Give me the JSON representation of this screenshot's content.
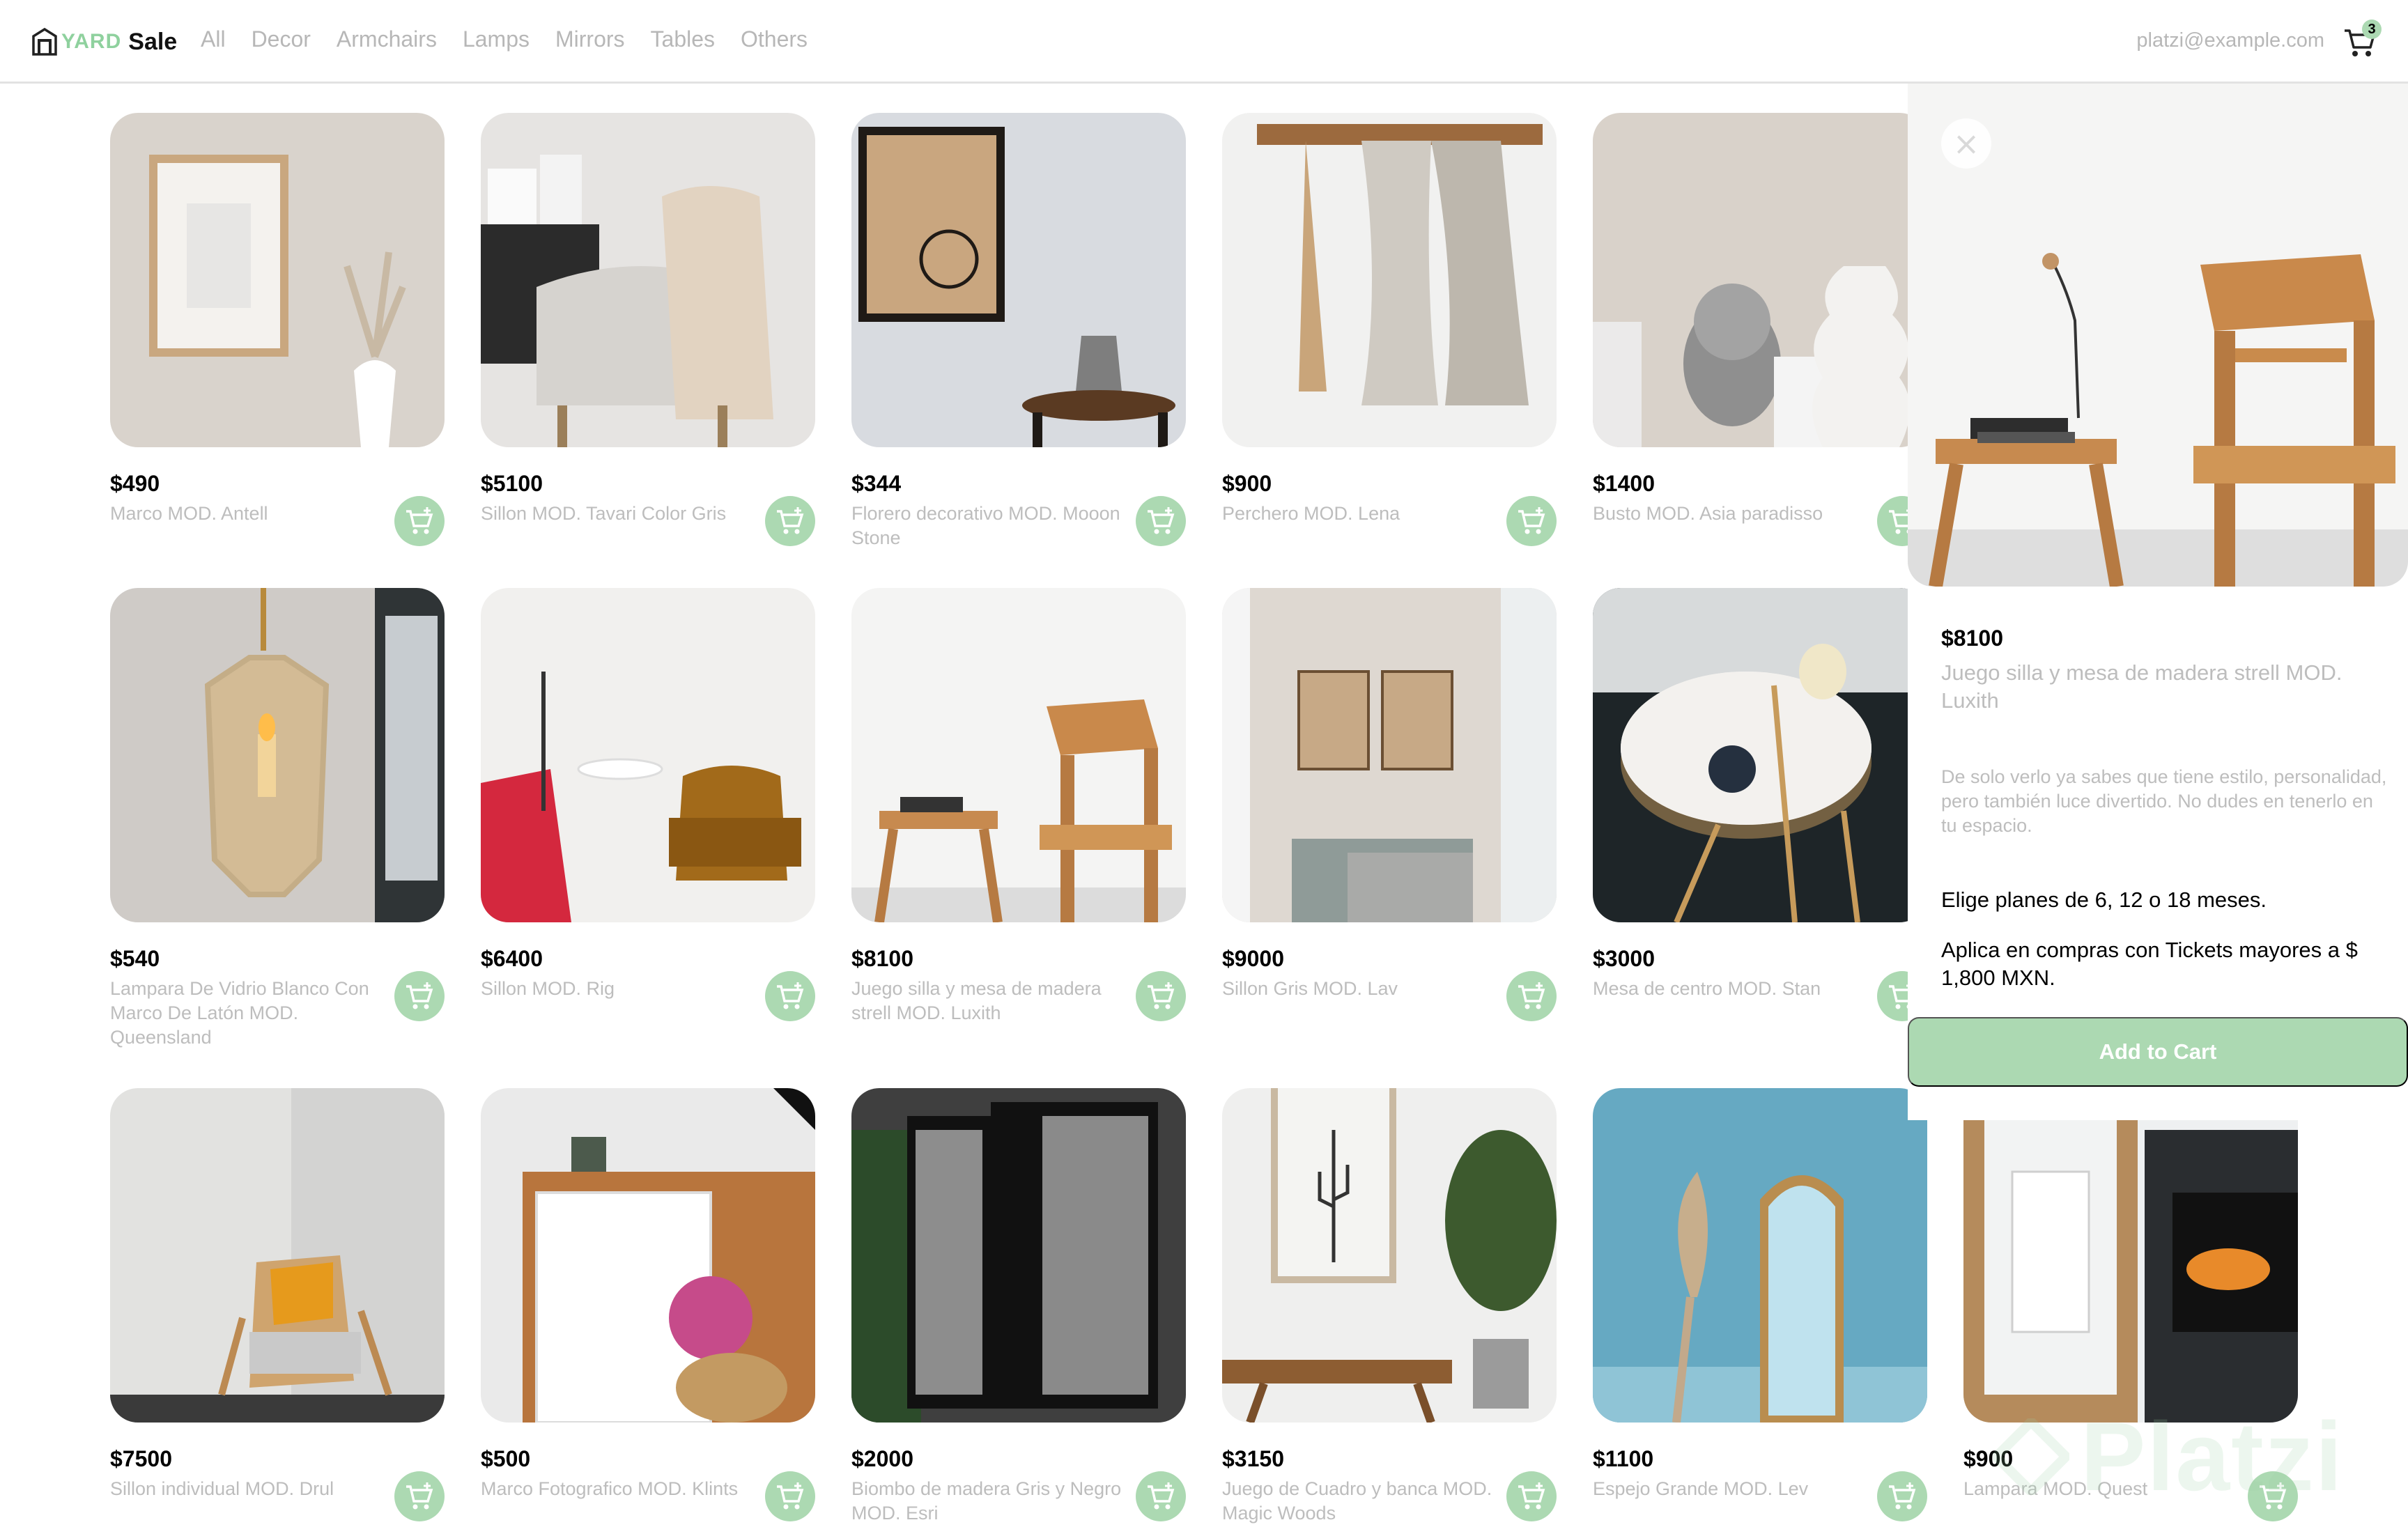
{
  "navbar": {
    "logo_yard": "YARD",
    "logo_sale": "Sale",
    "links": [
      "All",
      "Decor",
      "Armchairs",
      "Lamps",
      "Mirrors",
      "Tables",
      "Others"
    ],
    "email": "platzi@example.com",
    "cart_count": "3",
    "cart_icon": "shopping-cart-icon"
  },
  "products": [
    {
      "price": "$490",
      "name": "Marco MOD. Antell"
    },
    {
      "price": "$5100",
      "name": "Sillon MOD. Tavari Color Gris"
    },
    {
      "price": "$344",
      "name": "Florero decorativo MOD. Mooon Stone"
    },
    {
      "price": "$900",
      "name": "Perchero MOD. Lena"
    },
    {
      "price": "$1400",
      "name": "Busto MOD. Asia paradisso"
    },
    {
      "price": "$540",
      "name": "Lampara De Vidrio Blanco Con Marco De Latón MOD. Queensland"
    },
    {
      "price": "$6400",
      "name": "Sillon MOD. Rig"
    },
    {
      "price": "$8100",
      "name": "Juego silla y mesa de madera strell MOD. Luxith"
    },
    {
      "price": "$9000",
      "name": "Sillon Gris MOD. Lav"
    },
    {
      "price": "$3000",
      "name": "Mesa de centro MOD. Stan"
    },
    {
      "price": "$7500",
      "name": "Sillon individual MOD. Drul"
    },
    {
      "price": "$500",
      "name": "Marco Fotografico MOD. Klints"
    },
    {
      "price": "$2000",
      "name": "Biombo de madera Gris y Negro MOD. Esri"
    },
    {
      "price": "$3150",
      "name": "Juego de Cuadro y banca MOD. Magic Woods"
    },
    {
      "price": "$1100",
      "name": "Espejo Grande MOD. Lev"
    },
    {
      "price": "$900",
      "name": "Lampara MOD. Quest"
    }
  ],
  "detail": {
    "close_icon": "close-icon",
    "close_label": "×",
    "price": "$8100",
    "name": "Juego silla y mesa de madera strell MOD. Luxith",
    "description": "De solo verlo ya sabes que tiene estilo, personalidad, pero también luce divertido. No dudes en tenerlo en tu espacio.",
    "plans": "Elige planes de 6, 12 o 18 meses.",
    "apply": "Aplica en compras con Tickets mayores a $ 1,800 MXN.",
    "add_label": "Add to Cart"
  },
  "colors": {
    "accent": "#acd9b2",
    "logo_green": "#8fd19e",
    "muted_text": "#bdbdbd",
    "border": "#e2e2e2"
  },
  "watermark": {
    "text": "Platzi"
  }
}
